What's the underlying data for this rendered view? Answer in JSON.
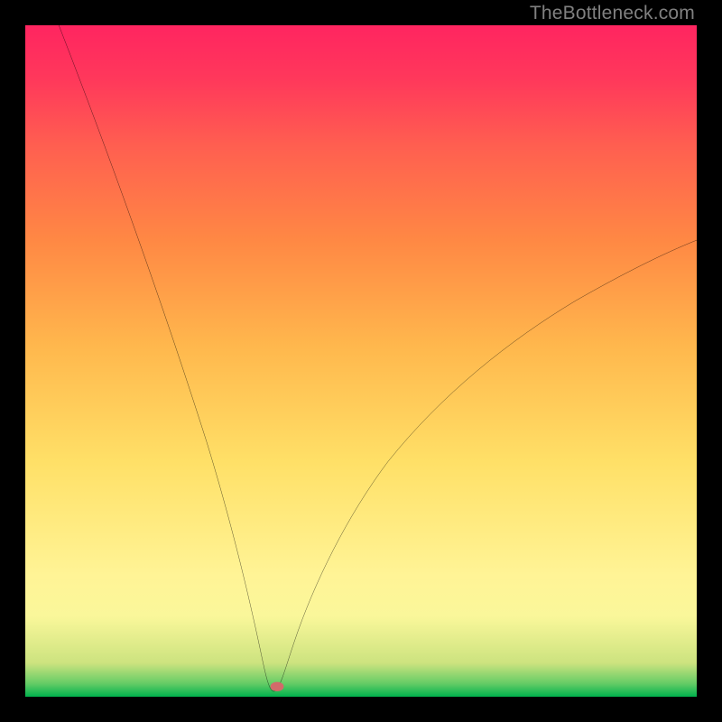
{
  "watermark": "TheBottleneck.com",
  "chart_data": {
    "type": "line",
    "title": "",
    "xlabel": "",
    "ylabel": "",
    "annotations": [],
    "legend": [],
    "xlim": [
      0,
      100
    ],
    "ylim": [
      0,
      100
    ],
    "grid": false,
    "minimum_x": 37,
    "minimum_y": 0,
    "left_branch": {
      "x_start": 5,
      "y_start": 100,
      "x_end": 37,
      "y_end": 0
    },
    "right_branch": {
      "x_start": 37,
      "y_start": 0,
      "x_end": 100,
      "y_end": 68
    },
    "series": [
      {
        "name": "curve",
        "x": [
          5,
          8,
          12,
          16,
          20,
          24,
          28,
          31,
          33,
          35,
          36,
          37,
          38,
          40,
          43,
          47,
          52,
          58,
          64,
          72,
          80,
          88,
          95,
          100
        ],
        "y": [
          100,
          91,
          79,
          67,
          55,
          43,
          31,
          21,
          15,
          8,
          3,
          0,
          1,
          4,
          10,
          18,
          27,
          36,
          43,
          51,
          57,
          62,
          66,
          68
        ]
      }
    ],
    "marker": {
      "x": 37.5,
      "y": 1.5,
      "color": "#d26a6a"
    },
    "colors": {
      "curve": "#000000",
      "background_top": "#ff2560",
      "background_bottom": "#00b24d",
      "frame": "#000000"
    }
  }
}
